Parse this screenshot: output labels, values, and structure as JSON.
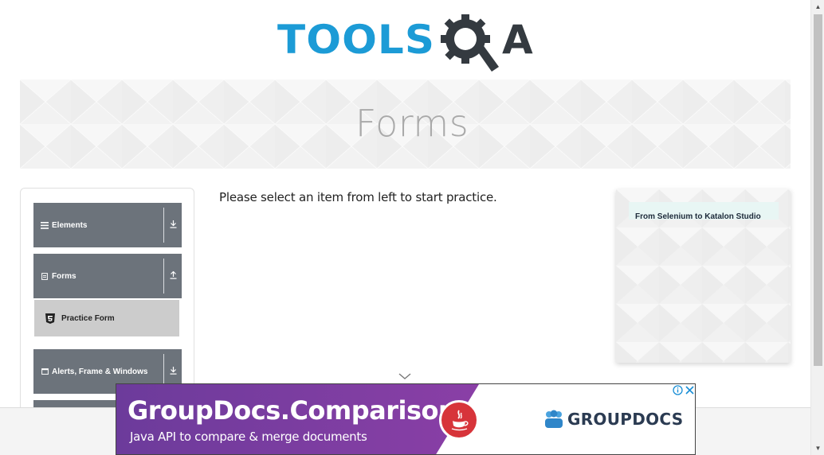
{
  "logo": {
    "text_left": "TOOLS",
    "text_right": "A"
  },
  "header": {
    "title": "Forms"
  },
  "sidebar": {
    "groups": [
      {
        "label": "Elements",
        "icon": "list-icon",
        "toggle": "download-arrow-icon"
      },
      {
        "label": "Forms",
        "icon": "document-icon",
        "toggle": "upload-arrow-icon"
      },
      {
        "label": "Alerts, Frame & Windows",
        "icon": "window-icon",
        "toggle": "download-arrow-icon"
      }
    ],
    "active_item": {
      "label": "Practice Form",
      "icon": "html5-icon"
    }
  },
  "main": {
    "message": "Please select an item from left to start practice."
  },
  "side_ad": {
    "text": "From Selenium to Katalon Studio"
  },
  "bottom_ad": {
    "headline": "GroupDocs.Comparison",
    "subline": "Java API to compare & merge documents",
    "brand": "GROUPDOCS"
  },
  "colors": {
    "logo_blue": "#1c9bd6",
    "logo_dark": "#343a40",
    "sidebar_group_bg": "#6c737b",
    "active_item_bg": "#cccccc",
    "ad_purple": "#7a3ea0",
    "java_red": "#d7343a"
  }
}
